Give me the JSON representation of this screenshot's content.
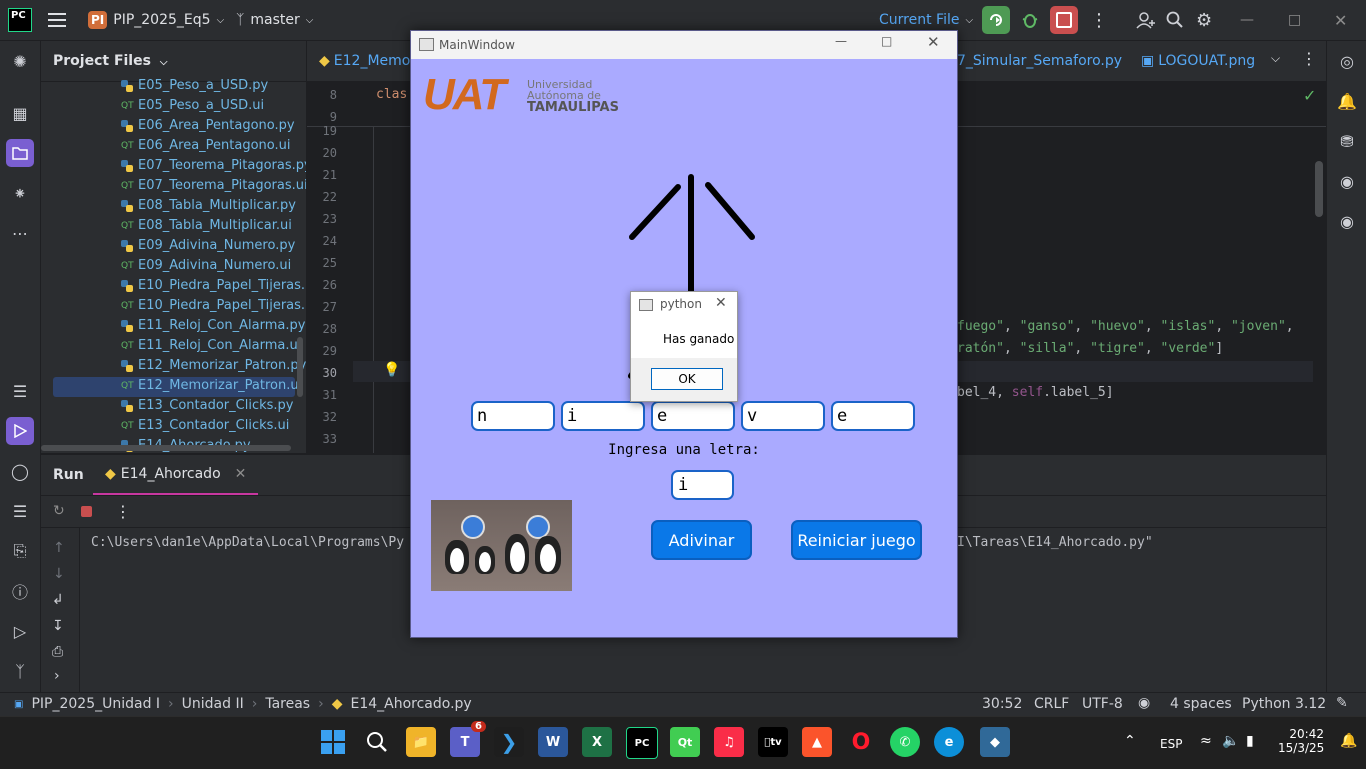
{
  "ide": {
    "logo": "PC",
    "project_badge": "PI",
    "project_name": "PIP_2025_Eq5",
    "branch": "master",
    "run_config": "Current File"
  },
  "project_panel": {
    "title": "Project Files",
    "files": [
      {
        "name": "E05_Peso_a_USD.py",
        "type": "py"
      },
      {
        "name": "E05_Peso_a_USD.ui",
        "type": "ui"
      },
      {
        "name": "E06_Area_Pentagono.py",
        "type": "py"
      },
      {
        "name": "E06_Area_Pentagono.ui",
        "type": "ui"
      },
      {
        "name": "E07_Teorema_Pitagoras.py",
        "type": "py"
      },
      {
        "name": "E07_Teorema_Pitagoras.ui",
        "type": "ui"
      },
      {
        "name": "E08_Tabla_Multiplicar.py",
        "type": "py"
      },
      {
        "name": "E08_Tabla_Multiplicar.ui",
        "type": "ui"
      },
      {
        "name": "E09_Adivina_Numero.py",
        "type": "py"
      },
      {
        "name": "E09_Adivina_Numero.ui",
        "type": "ui"
      },
      {
        "name": "E10_Piedra_Papel_Tijeras.py",
        "type": "py"
      },
      {
        "name": "E10_Piedra_Papel_Tijeras.ui",
        "type": "ui"
      },
      {
        "name": "E11_Reloj_Con_Alarma.py",
        "type": "py"
      },
      {
        "name": "E11_Reloj_Con_Alarma.ui",
        "type": "ui"
      },
      {
        "name": "E12_Memorizar_Patron.py",
        "type": "py"
      },
      {
        "name": "E12_Memorizar_Patron.ui",
        "type": "ui"
      },
      {
        "name": "E13_Contador_Clicks.py",
        "type": "py"
      },
      {
        "name": "E13_Contador_Clicks.ui",
        "type": "ui"
      },
      {
        "name": "E14_Ahorcado.py",
        "type": "py"
      }
    ]
  },
  "editor": {
    "tab_left": "E12_Memor",
    "tab_mid": "7_Simular_Semaforo.py",
    "tab_right": "LOGOUAT.png",
    "line_8": "8",
    "line_9": "9",
    "code_8": "clas",
    "line_numbers": [
      "19",
      "20",
      "21",
      "22",
      "23",
      "24",
      "25",
      "26",
      "27",
      "28",
      "29",
      "30",
      "31",
      "32",
      "33"
    ],
    "code_28": [
      "fuego\"",
      ", ",
      "\"ganso\"",
      ", ",
      "\"huevo\"",
      ", ",
      "\"islas\"",
      ", ",
      "\"joven\"",
      ","
    ],
    "code_29": [
      "ratón\"",
      ", ",
      "\"silla\"",
      ", ",
      "\"tigre\"",
      ", ",
      "\"verde\"",
      "]"
    ],
    "code_31": [
      "bel_4",
      ", ",
      "self",
      ".label_5]"
    ]
  },
  "run_panel": {
    "tab_run": "Run",
    "tab_config": "E14_Ahorcado",
    "console_left": "C:\\Users\\dan1e\\AppData\\Local\\Programs\\Py",
    "console_right": "I\\Tareas\\E14_Ahorcado.py\""
  },
  "status_bar": {
    "breadcrumb": [
      "PIP_2025_Unidad I",
      "Unidad II",
      "Tareas",
      "E14_Ahorcado.py"
    ],
    "position": "30:52",
    "line_ending": "CRLF",
    "encoding": "UTF-8",
    "indent": "4 spaces",
    "interpreter": "Python 3.12"
  },
  "main_window": {
    "title": "MainWindow",
    "logo_text": "UAT",
    "logo_line1": "Universidad",
    "logo_line2": "Autónoma de",
    "logo_line3": "TAMAULIPAS",
    "letters": [
      "n",
      "i",
      "e",
      "v",
      "e"
    ],
    "prompt": "Ingresa una letra:",
    "input_value": "i",
    "guess_button": "Adivinar",
    "restart_button": "Reiniciar juego"
  },
  "dialog": {
    "title": "python",
    "message": "Has ganado",
    "ok": "OK"
  },
  "taskbar": {
    "teams_badge": "6",
    "language": "ESP",
    "time": "20:42",
    "date": "15/3/25"
  },
  "colors": {
    "ide_bg": "#1e1f22",
    "panel_bg": "#2b2d30",
    "window_bg": "#aaaaff",
    "button_blue": "#0a78e8",
    "uat_orange": "#d2691e",
    "file_blue": "#6fb7e4"
  }
}
